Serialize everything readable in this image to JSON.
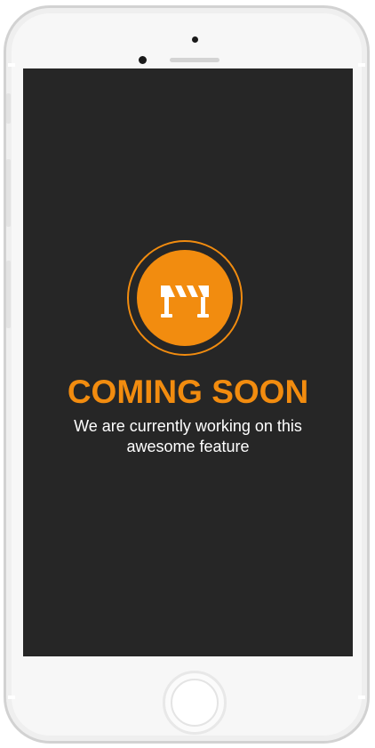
{
  "screen": {
    "title": "COMING SOON",
    "subtitle": "We are currently working on this awesome feature",
    "icon": "road-barrier-icon"
  },
  "colors": {
    "accent": "#f28c0f",
    "screen_background": "#262626",
    "text": "#ffffff",
    "device_frame": "#f7f7f7"
  }
}
